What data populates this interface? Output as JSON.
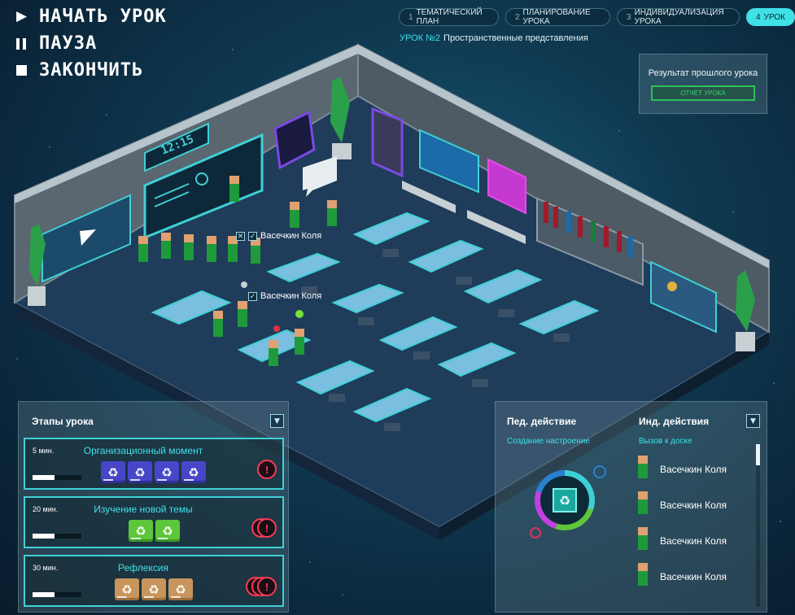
{
  "controls": {
    "start_label": "НАЧАТЬ УРОК",
    "pause_label": "ПАУЗА",
    "finish_label": "ЗАКОНЧИТЬ"
  },
  "tabs": [
    {
      "num": "1",
      "label": "ТЕМАТИЧЕСКИЙ ПЛАН",
      "active": false
    },
    {
      "num": "2",
      "label": "ПЛАНИРОВАНИЕ УРОКА",
      "active": false
    },
    {
      "num": "3",
      "label": "ИНДИВИДУАЛИЗАЦИЯ УРОКА",
      "active": false
    },
    {
      "num": "4",
      "label": "УРОК",
      "active": true
    }
  ],
  "lesson": {
    "number_label": "УРОК №2",
    "topic": "Пространственные представления"
  },
  "previous_result": {
    "title": "Результат прошлого урока",
    "report_button": "ОТЧЕТ УРОКА"
  },
  "classroom": {
    "clock": "12:15",
    "student_tag_1": "Васечкин Коля",
    "student_tag_2": "Васечкин Коля"
  },
  "stages_panel": {
    "title": "Этапы урока",
    "stages": [
      {
        "duration": "5 мин.",
        "name": "Организационный момент",
        "progress": 0.45,
        "card_color": "blue",
        "card_count": 4,
        "alert_count": 1
      },
      {
        "duration": "20 мин.",
        "name": "Изучение новой темы",
        "progress": 0.45,
        "card_color": "green",
        "card_count": 2,
        "alert_count": 2
      },
      {
        "duration": "30 мин.",
        "name": "Рефлексия",
        "progress": 0.45,
        "card_color": "tan",
        "card_count": 3,
        "alert_count": 3
      }
    ]
  },
  "actions_panel": {
    "ped_title": "Пед. действие",
    "ped_action": "Создание настроение",
    "ind_title": "Инд. действия",
    "ind_action": "Вызов к доске",
    "students": [
      "Васечкин Коля",
      "Васечкин Коля",
      "Васечкин Коля",
      "Васечкин Коля"
    ]
  },
  "icons": {
    "play": "play-icon",
    "pause": "pause-icon",
    "stop": "stop-icon",
    "recycle": "recycle-icon",
    "alert": "exclamation-icon",
    "dropdown": "chevron-down-icon"
  },
  "colors": {
    "accent": "#3fe0e6",
    "alert": "#ff3b56",
    "report": "#3fd069"
  }
}
